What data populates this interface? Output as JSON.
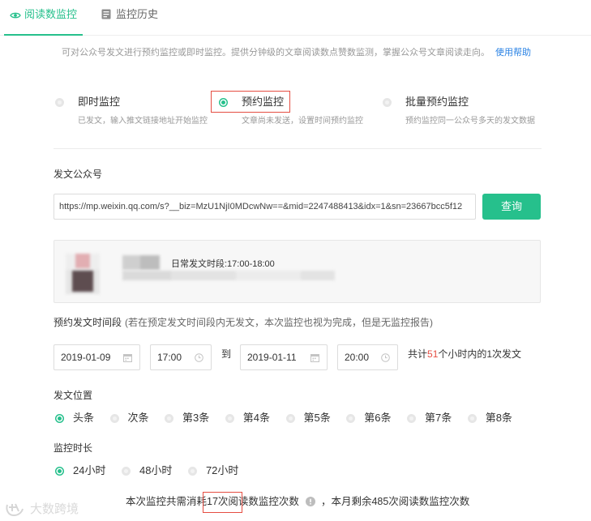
{
  "colors": {
    "accent": "#26c08c",
    "highlight": "#e54d42",
    "link": "#2a82e4"
  },
  "tabs": [
    {
      "label": "阅读数监控",
      "icon": "eye-icon",
      "active": true
    },
    {
      "label": "监控历史",
      "icon": "calendar-icon",
      "active": false
    }
  ],
  "intro": {
    "text": "可对公众号发文进行预约监控或即时监控。提供分钟级的文章阅读数点赞数监测，掌握公众号文章阅读走向。",
    "help_link": "使用帮助"
  },
  "modes": {
    "selected": 1,
    "items": [
      {
        "label": "即时监控",
        "desc": "已发文，输入推文链接地址开始监控"
      },
      {
        "label": "预约监控",
        "desc": "文章尚未发送，设置时间预约监控"
      },
      {
        "label": "批量预约监控",
        "desc": "预约监控同一公众号多天的发文数据"
      }
    ]
  },
  "account": {
    "label": "发文公众号",
    "url_value": "https://mp.weixin.qq.com/s?__biz=MzU1NjI0MDcwNw==&mid=2247488413&idx=1&sn=23667bcc5f12",
    "query_button": "查询",
    "posting_window": "日常发文时段:17:00-18:00"
  },
  "schedule": {
    "label": "预约发文时间段",
    "note": "(若在预定发文时间段内无发文，本次监控也视为完成，但是无监控报告)",
    "start_date": "2019-01-09",
    "start_time": "17:00",
    "separator": "到",
    "end_date": "2019-01-11",
    "end_time": "20:00",
    "summary_prefix": "共计",
    "summary_hours": "51",
    "summary_suffix": "个小时内的1次发文",
    "date_icon": "calendar-icon",
    "time_icon": "clock-icon"
  },
  "position": {
    "label": "发文位置",
    "selected": 0,
    "options": [
      "头条",
      "次条",
      "第3条",
      "第4条",
      "第5条",
      "第6条",
      "第7条",
      "第8条"
    ]
  },
  "duration": {
    "label": "监控时长",
    "selected": 0,
    "options": [
      "24小时",
      "48小时",
      "72小时"
    ]
  },
  "footer": {
    "cost_prefix": "本次监控共需消耗",
    "cost_highlight": "17次阅",
    "cost_suffix": "读数监控次数",
    "info_icon": "info-icon",
    "remaining": "，本月剩余485次阅读数监控次数"
  },
  "watermark": {
    "text": "大数跨境",
    "icon": "brand-logo-icon"
  }
}
